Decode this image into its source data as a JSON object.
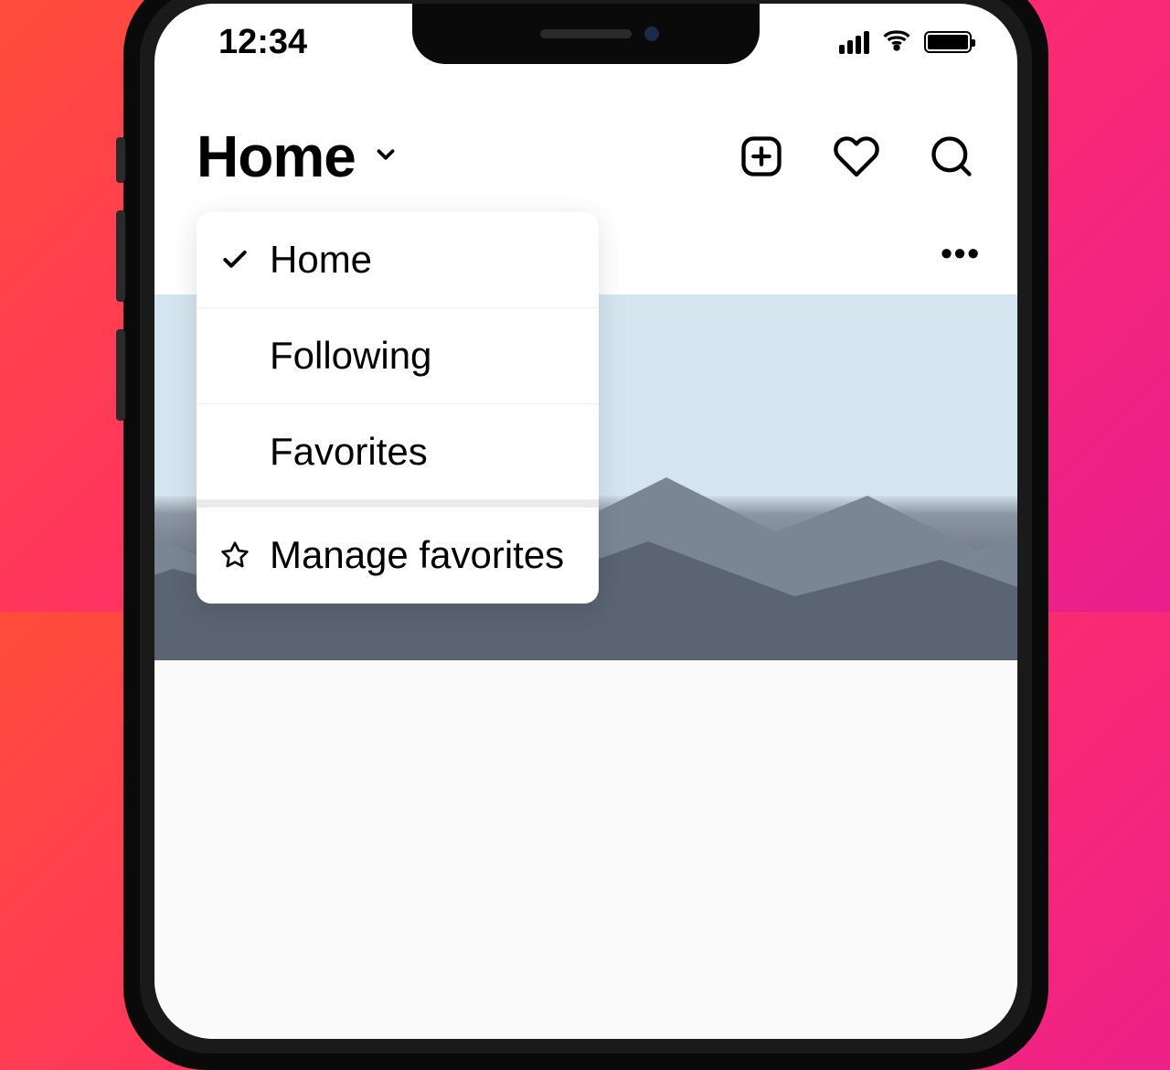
{
  "statusBar": {
    "time": "12:34"
  },
  "header": {
    "title": "Home"
  },
  "dropdown": {
    "items": [
      {
        "label": "Home",
        "selected": true,
        "icon": "check"
      },
      {
        "label": "Following",
        "selected": false,
        "icon": null
      },
      {
        "label": "Favorites",
        "selected": false,
        "icon": null
      },
      {
        "label": "Manage favorites",
        "selected": false,
        "icon": "star"
      }
    ]
  }
}
